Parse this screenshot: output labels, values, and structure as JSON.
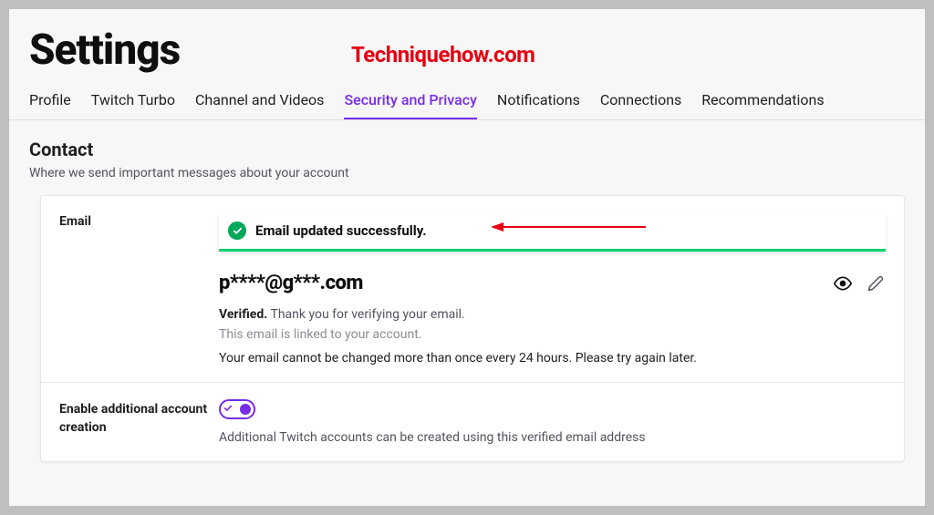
{
  "watermark": "Techniquehow.com",
  "header": {
    "title": "Settings"
  },
  "tabs": {
    "items": [
      {
        "label": "Profile"
      },
      {
        "label": "Twitch Turbo"
      },
      {
        "label": "Channel and Videos"
      },
      {
        "label": "Security and Privacy"
      },
      {
        "label": "Notifications"
      },
      {
        "label": "Connections"
      },
      {
        "label": "Recommendations"
      }
    ]
  },
  "section": {
    "title": "Contact",
    "desc": "Where we send important messages about your account"
  },
  "email": {
    "label": "Email",
    "alert": "Email updated successfully.",
    "value": "p****@g***.com",
    "verified_label": "Verified.",
    "verified_text": " Thank you for verifying your email.",
    "linked_text": "This email is linked to your account.",
    "cooldown_text": "Your email cannot be changed more than once every 24 hours. Please try again later."
  },
  "additional": {
    "label": "Enable additional account creation",
    "desc": "Additional Twitch accounts can be created using this verified email address"
  }
}
